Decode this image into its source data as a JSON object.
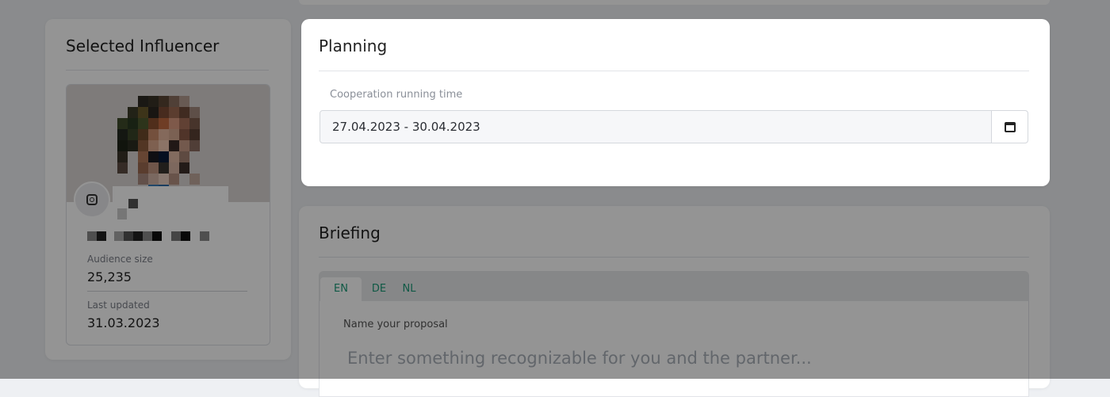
{
  "influencer": {
    "title": "Selected Influencer",
    "audience_label": "Audience size",
    "audience_value": "25,235",
    "updated_label": "Last updated",
    "updated_value": "31.03.2023",
    "platform_icon": "instagram-icon"
  },
  "planning": {
    "title": "Planning",
    "running_time_label": "Cooperation running time",
    "running_time_value": "27.04.2023 - 30.04.2023",
    "calendar_icon": "calendar-icon"
  },
  "briefing": {
    "title": "Briefing",
    "tabs": [
      {
        "label": "EN",
        "active": true
      },
      {
        "label": "DE",
        "active": false
      },
      {
        "label": "NL",
        "active": false
      }
    ],
    "proposal_label": "Name your proposal",
    "proposal_placeholder": "Enter something recognizable for you and the partner..."
  },
  "colors": {
    "accent": "#1b9a78",
    "overlay": "rgba(0,0,0,0.42)"
  }
}
